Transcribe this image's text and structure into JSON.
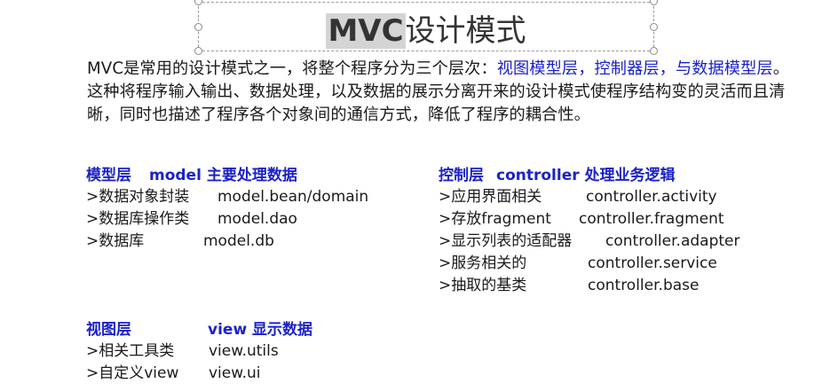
{
  "title": {
    "highlight": "MVC",
    "rest": "设计模式"
  },
  "intro": {
    "p1": "MVC是常用的设计模式之一，将整个程序分为三个层次：",
    "view_layer": "视图模型层",
    "sep1": "，",
    "controller_layer": "控制器层",
    "sep2": "，与",
    "model_layer": "数据模型层",
    "p2": "。这种将程序输入输出、数据处理，以及数据的展示分离开来的设计模式使程序结构变的灵活而且清晰，同时也描述了程序各个对象间的通信方式，降低了程序的耦合性。"
  },
  "model": {
    "heading": "模型层",
    "subtitle": "model 主要处理数据",
    "items": [
      {
        "k": ">数据对象封装",
        "v": "model.bean/domain"
      },
      {
        "k": ">数据库操作类",
        "v": "model.dao"
      },
      {
        "k": ">数据库",
        "v": "model.db"
      }
    ]
  },
  "controller": {
    "heading": "控制层",
    "subtitle": "controller 处理业务逻辑",
    "items": [
      {
        "k": ">应用界面相关",
        "v": "controller.activity"
      },
      {
        "k": ">存放fragment",
        "v": "controller.fragment"
      },
      {
        "k": ">显示列表的适配器",
        "v": "controller.adapter"
      },
      {
        "k": ">服务相关的",
        "v": "controller.service"
      },
      {
        "k": ">抽取的基类",
        "v": "controller.base"
      }
    ]
  },
  "view": {
    "heading": "视图层",
    "subtitle": "view 显示数据",
    "items": [
      {
        "k": ">相关工具类",
        "v": "view.utils"
      },
      {
        "k": ">自定义view",
        "v": "view.ui"
      }
    ]
  }
}
